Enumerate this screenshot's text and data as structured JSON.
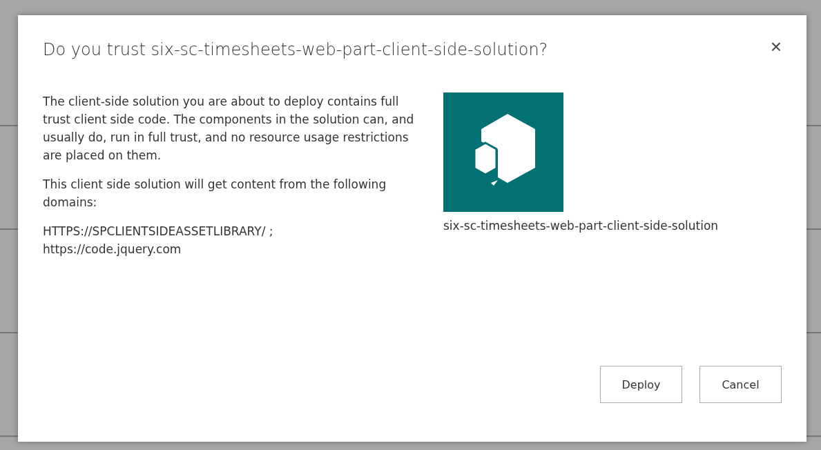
{
  "dialog": {
    "title": "Do you trust six-sc-timesheets-web-part-client-side-solution?",
    "close": "×",
    "paragraphs": [
      "The client-side solution you are about to deploy contains full trust client side code. The components in the solution can, and usually do, run in full trust, and no resource usage restrictions are placed on them.",
      "This client side solution will get content from the following domains:"
    ],
    "domains": [
      "HTTPS://SPCLIENTSIDEASSETLIBRARY/ ;",
      "https://code.jquery.com"
    ],
    "app": {
      "name": "six-sc-timesheets-web-part-client-side-solution"
    },
    "buttons": [
      {
        "label": "Deploy"
      },
      {
        "label": "Cancel"
      }
    ]
  }
}
